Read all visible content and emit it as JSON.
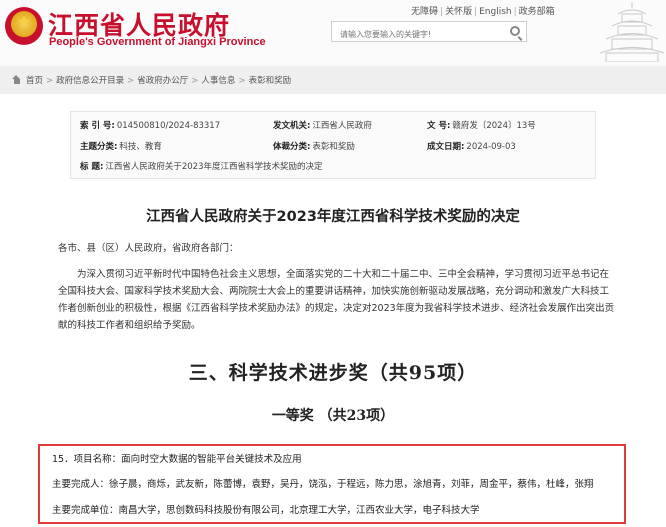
{
  "header": {
    "site_title": "江西省人民政府",
    "site_subtitle": "People's Government of Jiangxi Province",
    "top_links": [
      "无障碍",
      "关怀版",
      "English",
      "政务部箱"
    ],
    "search_placeholder": "请输入您要输入的关键字!"
  },
  "breadcrumb": [
    "首页",
    "政府信息公开目录",
    "省政府办公厅",
    "人事信息",
    "表彰和奖励"
  ],
  "meta": {
    "index_label": "索 引 号:",
    "index_value": "014500810/2024-83317",
    "issuer_label": "发文机关:",
    "issuer_value": "江西省人民政府",
    "doc_no_label": "文      号:",
    "doc_no_value": "赣府发〔2024〕13号",
    "topic_label": "主题分类:",
    "topic_value": "科技、教育",
    "genre_label": "体裁分类:",
    "genre_value": "表彰和奖励",
    "date_label": "成文日期:",
    "date_value": "2024-09-03",
    "title_label": "标      题:",
    "title_value": "江西省人民政府关于2023年度江西省科学技术奖励的决定"
  },
  "article": {
    "title": "江西省人民政府关于2023年度江西省科学技术奖励的决定",
    "addressee": "各市、县（区）人民政府，省政府各部门：",
    "body": "为深入贯彻习近平新时代中国特色社会主义思想，全面落实党的二十大和二十届二中、三中全会精神，学习贯彻习近平总书记在全国科技大会、国家科学技术奖励大会、两院院士大会上的重要讲话精神，加快实施创新驱动发展战略，充分调动和激发广大科技工作者创新创业的积极性，根据《江西省科学技术奖励办法》的规定，决定对2023年度为我省科学技术进步、经济社会发展作出突出贡献的科技工作者和组织给予奖励。",
    "section_heading": "三、科学技术进步奖（共95项）",
    "sub_heading": "一等奖 （共23项）",
    "project_line": "15．项目名称：面向时空大数据的智能平台关键技术及应用",
    "people_line": "主要完成人：徐子晨，商烁，武友新，陈蕾博，袁野，吴丹，饶泓，于程远，陈力思，涂旭青，刘菲，周金平，蔡伟，杜峰，张翔",
    "units_line": "主要完成单位：南昌大学，思创数码科技股份有限公司，北京理工大学，江西农业大学，电子科技大学"
  },
  "colors": {
    "brand_red": "#c8102e",
    "highlight_border": "#e23a3a",
    "breadcrumb_bg": "#efefef"
  }
}
